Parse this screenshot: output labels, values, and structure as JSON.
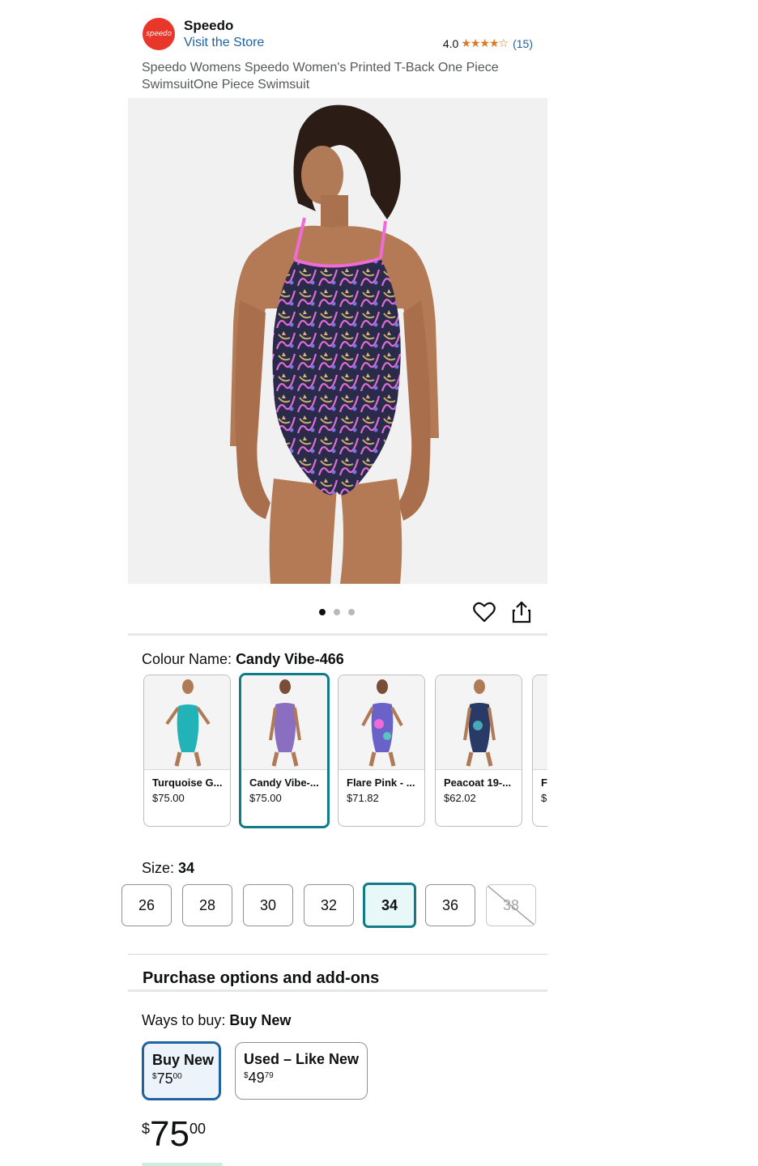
{
  "header": {
    "brand_logo_text": "speedo",
    "brand": "Speedo",
    "visit_store": "Visit the Store",
    "rating_value": "4.0",
    "rating_stars": 4,
    "rating_count": "(15)",
    "title": "Speedo Womens Speedo Women's Printed T-Back One Piece SwimsuitOne Piece Swimsuit"
  },
  "gallery": {
    "image_count": 3,
    "active_index": 0,
    "icons": [
      "heart-icon",
      "share-icon"
    ]
  },
  "colour": {
    "label": "Colour Name:",
    "selected": "Candy Vibe-466",
    "swatches": [
      {
        "name": "Turquoise G...",
        "price": "$75.00",
        "color": "#22b3b9"
      },
      {
        "name": "Candy Vibe-...",
        "price": "$75.00",
        "color": "#8a6fc1"
      },
      {
        "name": "Flare Pink - ...",
        "price": "$71.82",
        "color": "#6a62c8"
      },
      {
        "name": "Peacoat 19-...",
        "price": "$62.02",
        "color": "#2a3a66"
      },
      {
        "name": "Fl",
        "price": "$",
        "color": "#999999"
      }
    ]
  },
  "size": {
    "label": "Size:",
    "selected": "34",
    "options": [
      "26",
      "28",
      "30",
      "32",
      "34",
      "36",
      "38"
    ],
    "unavailable": [
      "38"
    ]
  },
  "purchase": {
    "title": "Purchase options and add-ons",
    "ways_label": "Ways to buy:",
    "ways_selected": "Buy New",
    "options": [
      {
        "label": "Buy New",
        "dollars": "75",
        "cents": "00"
      },
      {
        "label": "Used – Like New",
        "dollars": "49",
        "cents": "79"
      }
    ],
    "currency": "$",
    "price_dollars": "75",
    "price_cents": "00"
  },
  "colors": {
    "link": "#2162a1",
    "star": "#de7921",
    "selected_teal": "#127b87",
    "brand_red": "#e8362b"
  }
}
